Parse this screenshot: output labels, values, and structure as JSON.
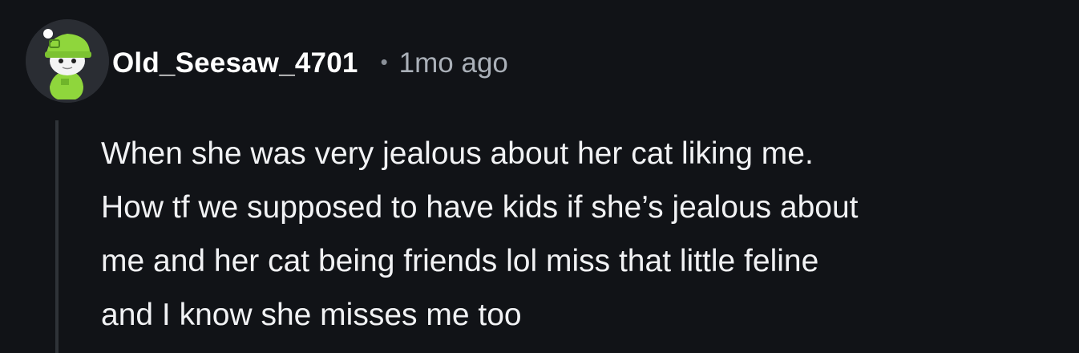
{
  "comment": {
    "author": "Old_Seesaw_4701",
    "separator": "•",
    "timestamp": "1mo ago",
    "avatar_icon": "snoo-avatar-green-hat-icon",
    "body_lines": [
      "When she was very jealous about her cat liking me.",
      "How tf we supposed to have kids if she’s jealous about",
      "me and her cat being friends lol miss that little feline",
      "and I know she misses me too"
    ]
  },
  "colors": {
    "background": "#111317",
    "username": "#ffffff",
    "meta": "#aab0b8",
    "body": "#f1f2f4",
    "thread_line": "#2f3338",
    "avatar_green": "#8fd63c"
  }
}
